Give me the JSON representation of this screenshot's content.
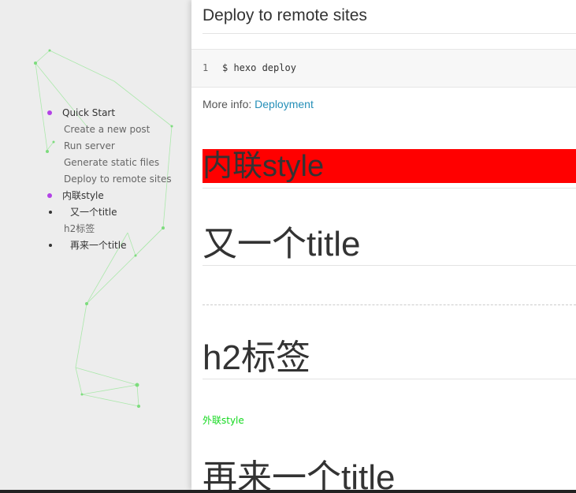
{
  "sidebar": {
    "toc": [
      {
        "label": "Quick Start",
        "level": 1,
        "bullet": "purple"
      },
      {
        "label": "Create a new post",
        "level": 2
      },
      {
        "label": "Run server",
        "level": 2
      },
      {
        "label": "Generate static files",
        "level": 2
      },
      {
        "label": "Deploy to remote sites",
        "level": 2
      },
      {
        "label": "内联style",
        "level": 1,
        "bullet": "purple"
      },
      {
        "label": "又一个title",
        "level": 1,
        "bullet": "black"
      },
      {
        "label": "h2标签",
        "level": 2
      },
      {
        "label": "再来一个title",
        "level": 1,
        "bullet": "black"
      }
    ]
  },
  "main": {
    "section_heading": "Deploy to remote sites",
    "code": {
      "line_number": "1",
      "text": "$ hexo deploy"
    },
    "more_info_label": "More info:",
    "more_info_link": "Deployment",
    "inline_style_heading": "内联style",
    "heading_another_title": "又一个title",
    "heading_h2_tag": "h2标签",
    "external_style_text": "外联style",
    "heading_again_title": "再来一个title"
  },
  "colors": {
    "accent_link": "#258fb8",
    "bullet_purple": "#b342e6",
    "inline_bg": "#ff0000",
    "external_style": "#14d91f"
  }
}
